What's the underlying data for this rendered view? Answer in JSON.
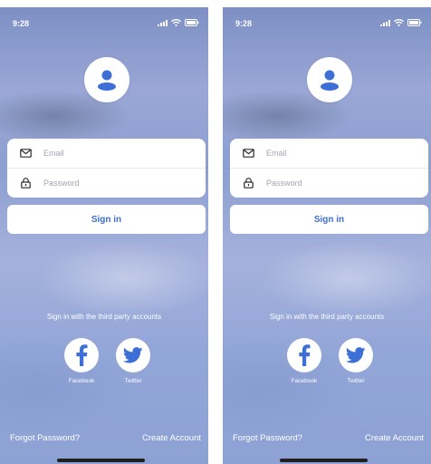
{
  "screens": [
    {
      "status_time": "9:28",
      "email_placeholder": "Email",
      "password_placeholder": "Password",
      "sign_in_label": "Sign in",
      "third_party_text": "Sign in with the third party accounts",
      "facebook_label": "Facebook",
      "twitter_label": "Twitter",
      "forgot_password_label": "Forgot Password?",
      "create_account_label": "Create Account"
    },
    {
      "status_time": "9:28",
      "email_placeholder": "Email",
      "password_placeholder": "Password",
      "sign_in_label": "Sign in",
      "third_party_text": "Sign in with the third party accounts",
      "facebook_label": "Facebook",
      "twitter_label": "Twitter",
      "forgot_password_label": "Forgot Password?",
      "create_account_label": "Create Account"
    }
  ],
  "colors": {
    "accent": "#3d6fd6",
    "card_background": "#ffffff",
    "text_on_background": "#ffffff"
  },
  "icons": [
    "user-icon",
    "mail-icon",
    "lock-icon",
    "facebook-icon",
    "twitter-icon",
    "signal-icon",
    "wifi-icon",
    "battery-icon"
  ]
}
